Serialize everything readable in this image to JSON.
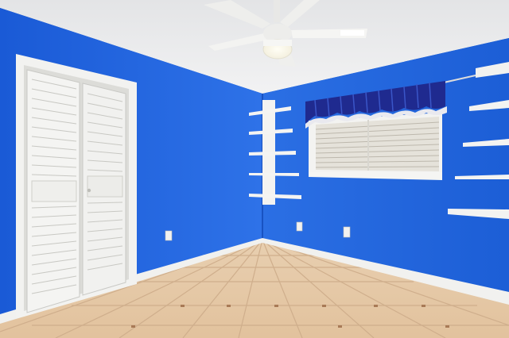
{
  "scene": {
    "description_free": true,
    "colors": {
      "wall_left": "#1e64de",
      "wall_back": "#2a72e6",
      "wall_right": "#1f5fd6",
      "ceiling": "#e9eaec",
      "floor_tile": "#e7c9a6",
      "floor_grout": "#c9a98a",
      "trim": "#f2f2f0",
      "valance": "#1f2a8f",
      "blind": "#e9e6df"
    },
    "elements": {
      "closet": "bifold-louvered-door",
      "fan": "ceiling-fan",
      "window": "window-with-blinds",
      "shelves_corner": "floating-corner-shelves",
      "shelves_right": "floating-wall-shelves",
      "outlets": "electrical-outlets"
    }
  }
}
